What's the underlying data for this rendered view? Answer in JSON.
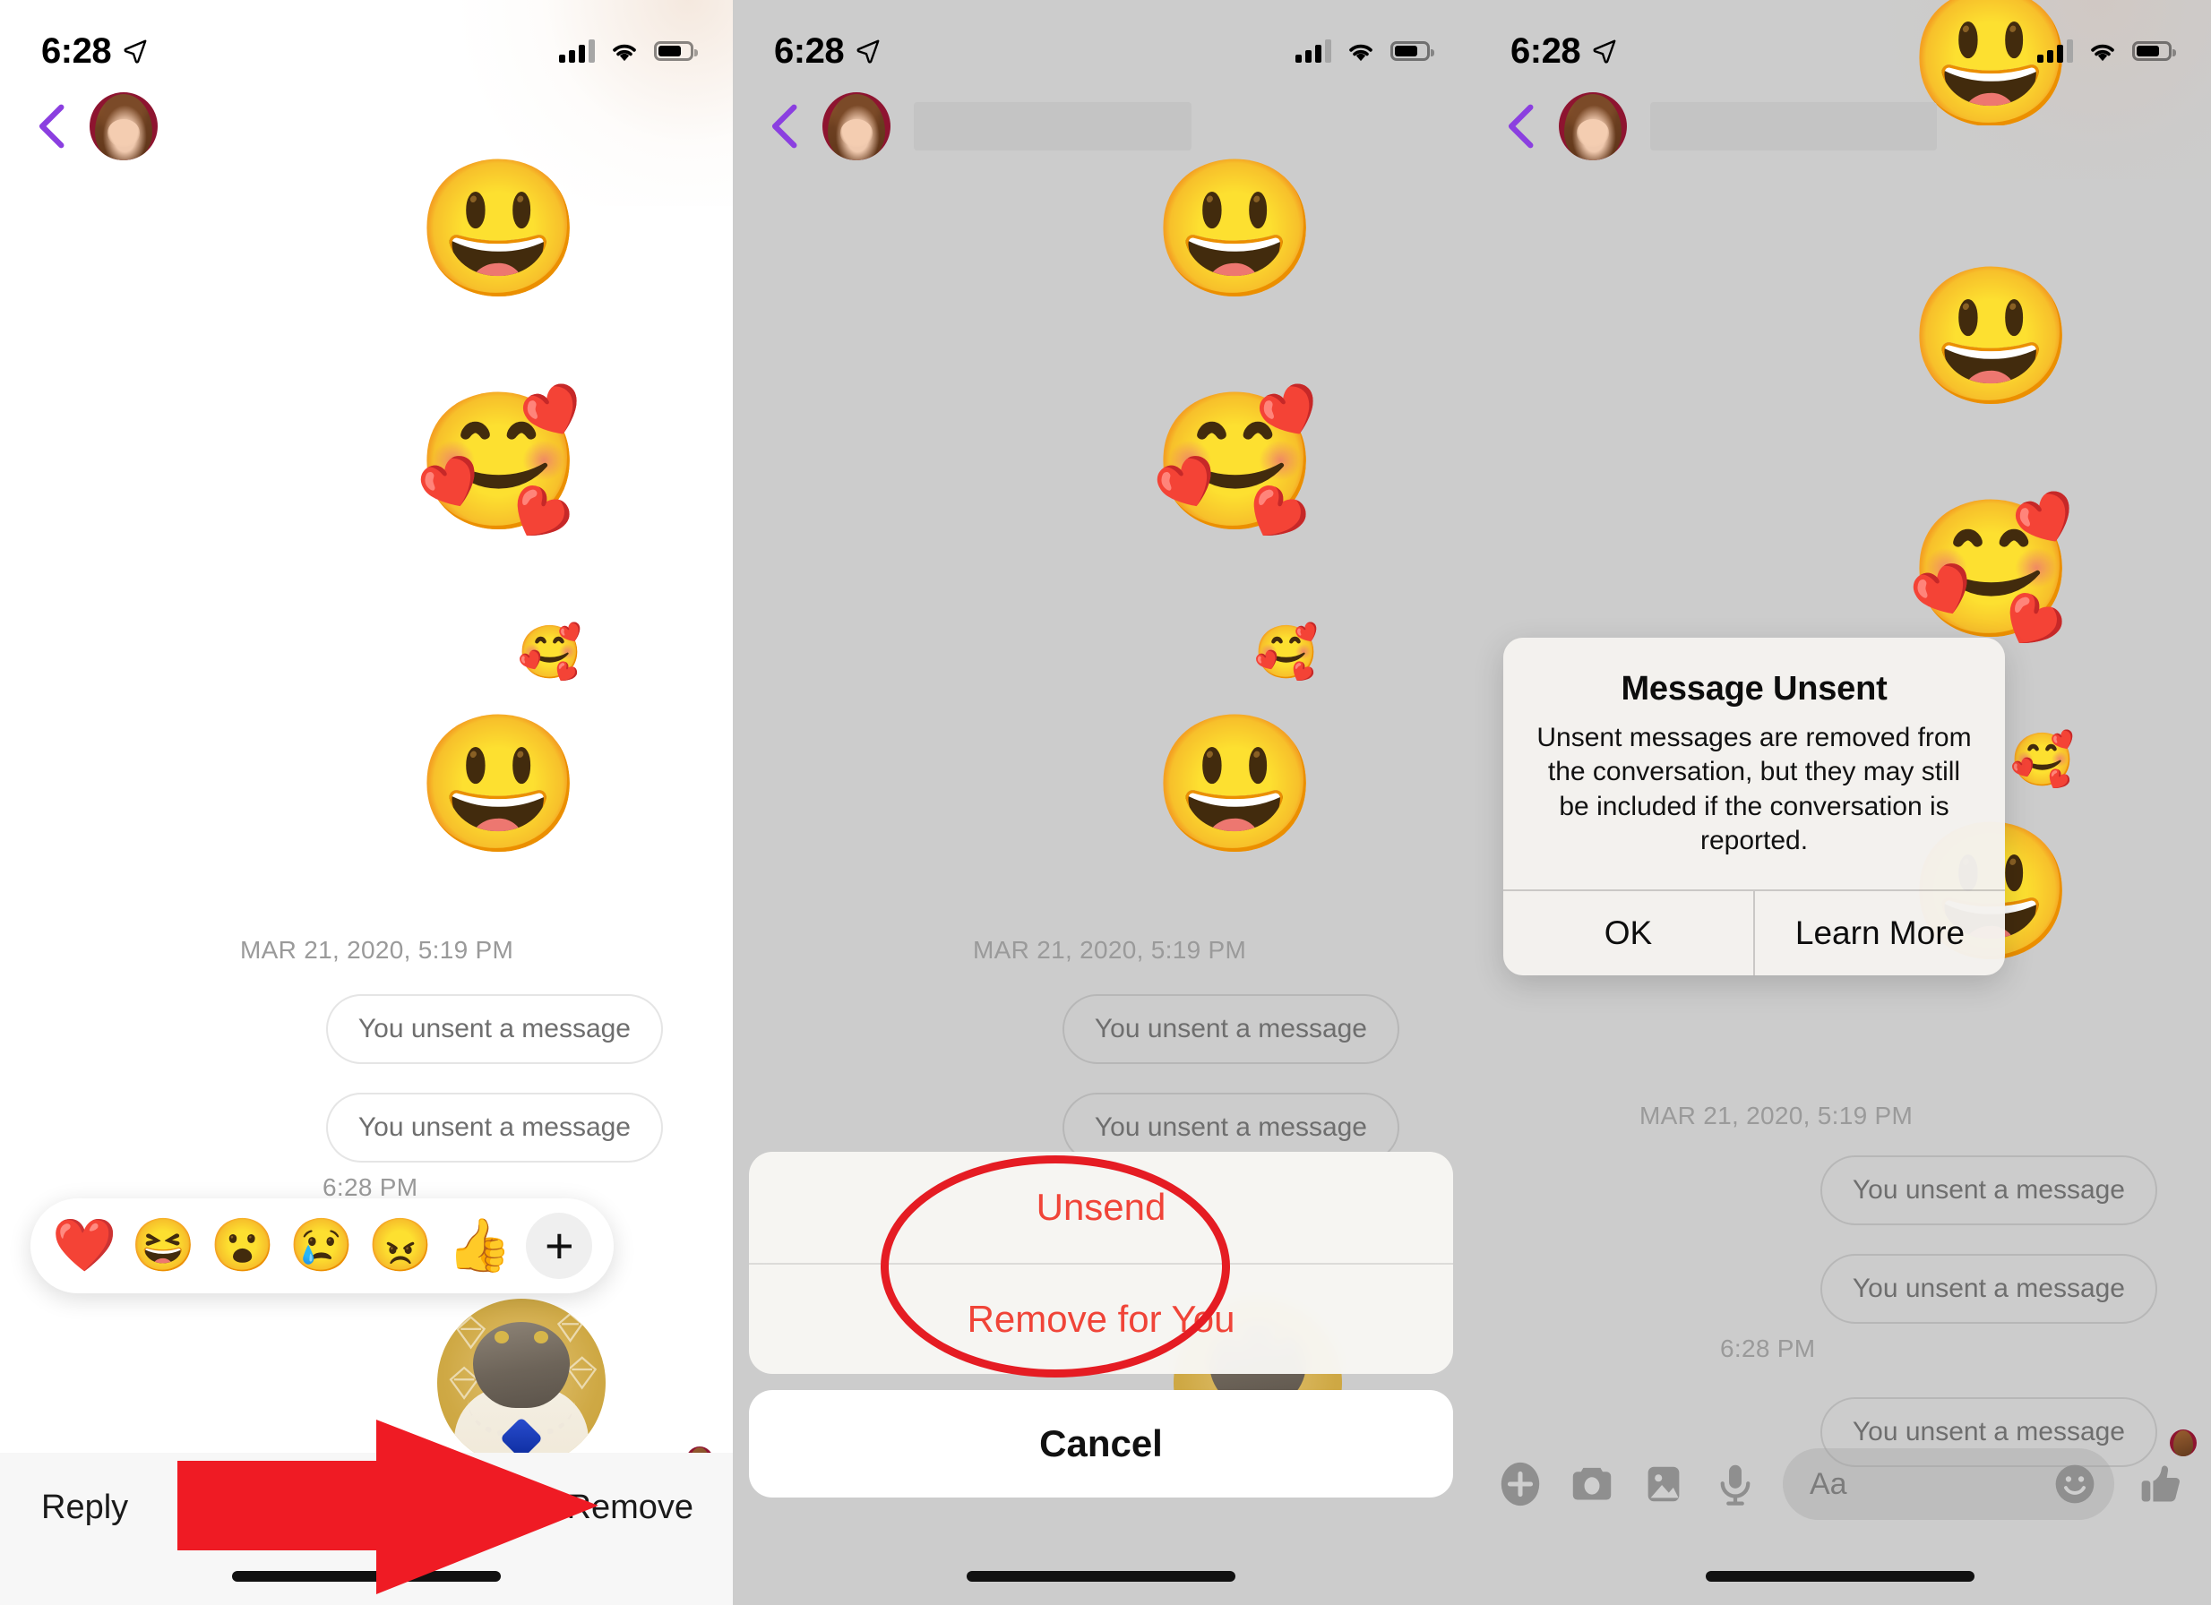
{
  "meta": {
    "screen_count": 3,
    "accent_back_chevron": "#8b3fe0",
    "destructive_red": "#f04438",
    "annotation_red": "#e51c23",
    "panel1_bg": "#ffffff",
    "panel_dimmed_bg": "#cccccc"
  },
  "status_bar": {
    "time": "6:28",
    "location_icon": "location-arrow-icon",
    "signal_icon": "cellular-signal-icon",
    "wifi_icon": "wifi-icon",
    "battery_icon": "battery-icon"
  },
  "nav": {
    "back_icon": "back-chevron-icon",
    "avatar_name": "contact-avatar",
    "contact_name_redacted": ""
  },
  "thread": {
    "emoji_grin": "😃",
    "emoji_hearts": "🥰",
    "timestamp_date": "MAR 21, 2020, 5:19 PM",
    "timestamp_time": "6:28 PM",
    "unsent_text": "You unsent a message"
  },
  "panel1": {
    "reactions": [
      {
        "name": "reaction-heart",
        "glyph": "❤️"
      },
      {
        "name": "reaction-laughing",
        "glyph": "😆"
      },
      {
        "name": "reaction-wow",
        "glyph": "😮"
      },
      {
        "name": "reaction-sad",
        "glyph": "😢"
      },
      {
        "name": "reaction-angry",
        "glyph": "😠"
      },
      {
        "name": "reaction-like",
        "glyph": "👍"
      }
    ],
    "reaction_add_label": "+",
    "toolbar": {
      "reply_label": "Reply",
      "remove_label": "Remove"
    },
    "cat_sticker_name": "cat-photo-sticker"
  },
  "panel2": {
    "action_sheet": {
      "unsend_label": "Unsend",
      "remove_for_you_label": "Remove for You",
      "cancel_label": "Cancel"
    }
  },
  "panel3": {
    "alert": {
      "title": "Message Unsent",
      "message": "Unsent messages are removed from the conversation, but they may still be included if the conversation is reported.",
      "ok_label": "OK",
      "learn_more_label": "Learn More"
    },
    "input_bar": {
      "plus_icon": "plus-circle-icon",
      "camera_icon": "camera-icon",
      "photo_icon": "photo-library-icon",
      "mic_icon": "microphone-icon",
      "text_placeholder": "Aa",
      "emoji_icon": "emoji-smiley-icon",
      "thumb_icon": "thumbs-up-icon"
    }
  }
}
